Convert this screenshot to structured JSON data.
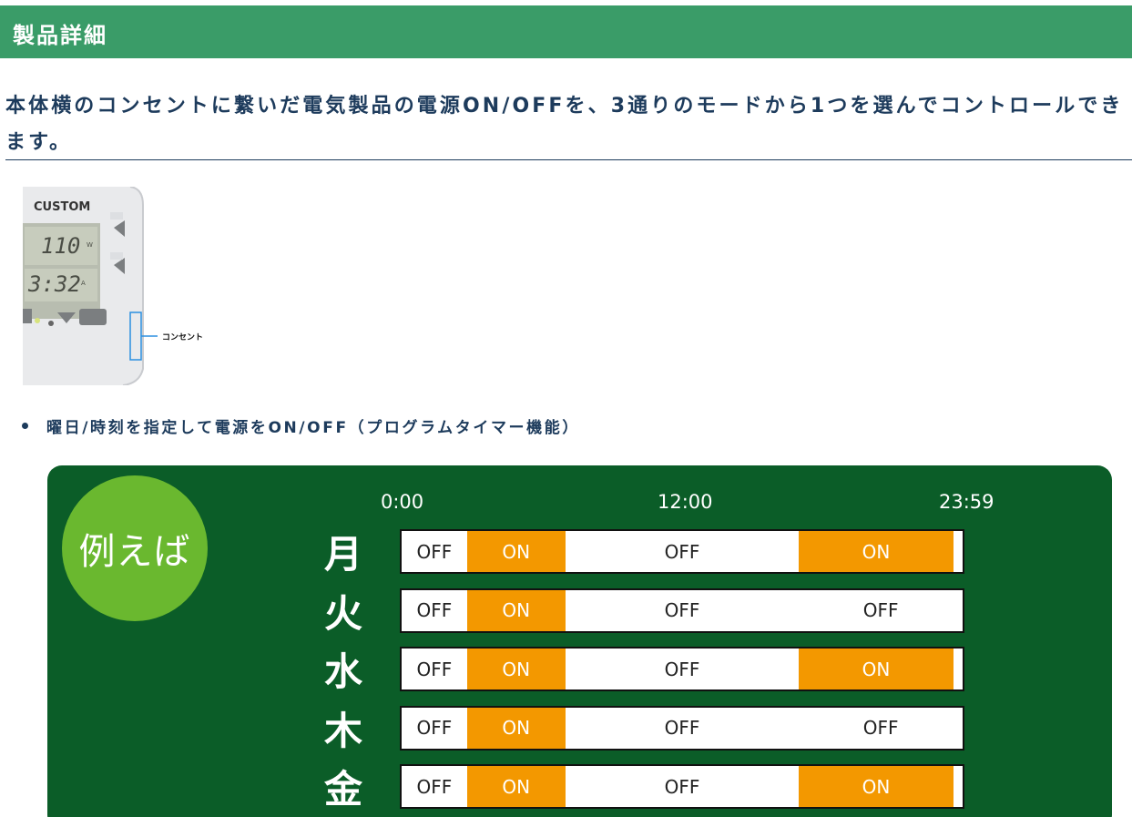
{
  "header": {
    "title": "製品詳細"
  },
  "lead": {
    "text": "本体横のコンセントに繋いだ電気製品の電源ON/OFFを、3通りのモードから1つを選んでコントロールできます。"
  },
  "product_image": {
    "brand": "CUSTOM",
    "display_top": "110",
    "display_top_unit": "W",
    "display_bottom": "3:32",
    "display_bottom_unit": "A",
    "callout": "コンセント"
  },
  "bullet": {
    "text": "曜日/時刻を指定して電源をON/OFF（プログラムタイマー機能）"
  },
  "schedule": {
    "badge": "例えば",
    "time_labels": [
      "0:00",
      "12:00",
      "23:59"
    ],
    "days": [
      {
        "name": "月",
        "segments": [
          {
            "label": "OFF",
            "on": false,
            "from": 0,
            "to": 2.8
          },
          {
            "label": "ON",
            "on": true,
            "from": 2.8,
            "to": 7.0
          },
          {
            "label": "OFF",
            "on": false,
            "from": 7.0,
            "to": 17.0
          },
          {
            "label": "ON",
            "on": true,
            "from": 17.0,
            "to": 23.6
          },
          {
            "label": "",
            "on": false,
            "from": 23.6,
            "to": 24
          }
        ]
      },
      {
        "name": "火",
        "segments": [
          {
            "label": "OFF",
            "on": false,
            "from": 0,
            "to": 2.8
          },
          {
            "label": "ON",
            "on": true,
            "from": 2.8,
            "to": 7.0
          },
          {
            "label": "OFF",
            "on": false,
            "from": 7.0,
            "to": 17.0
          },
          {
            "label": "OFF",
            "on": false,
            "from": 17.0,
            "to": 24
          }
        ]
      },
      {
        "name": "水",
        "segments": [
          {
            "label": "OFF",
            "on": false,
            "from": 0,
            "to": 2.8
          },
          {
            "label": "ON",
            "on": true,
            "from": 2.8,
            "to": 7.0
          },
          {
            "label": "OFF",
            "on": false,
            "from": 7.0,
            "to": 17.0
          },
          {
            "label": "ON",
            "on": true,
            "from": 17.0,
            "to": 23.6
          },
          {
            "label": "",
            "on": false,
            "from": 23.6,
            "to": 24
          }
        ]
      },
      {
        "name": "木",
        "segments": [
          {
            "label": "OFF",
            "on": false,
            "from": 0,
            "to": 2.8
          },
          {
            "label": "ON",
            "on": true,
            "from": 2.8,
            "to": 7.0
          },
          {
            "label": "OFF",
            "on": false,
            "from": 7.0,
            "to": 17.0
          },
          {
            "label": "OFF",
            "on": false,
            "from": 17.0,
            "to": 24
          }
        ]
      },
      {
        "name": "金",
        "segments": [
          {
            "label": "OFF",
            "on": false,
            "from": 0,
            "to": 2.8
          },
          {
            "label": "ON",
            "on": true,
            "from": 2.8,
            "to": 7.0
          },
          {
            "label": "OFF",
            "on": false,
            "from": 7.0,
            "to": 17.0
          },
          {
            "label": "ON",
            "on": true,
            "from": 17.0,
            "to": 23.6
          },
          {
            "label": "",
            "on": false,
            "from": 23.6,
            "to": 24
          }
        ]
      }
    ],
    "colors": {
      "panel": "#0b5d28",
      "on": "#f39800",
      "badge": "#6ab82f"
    }
  }
}
